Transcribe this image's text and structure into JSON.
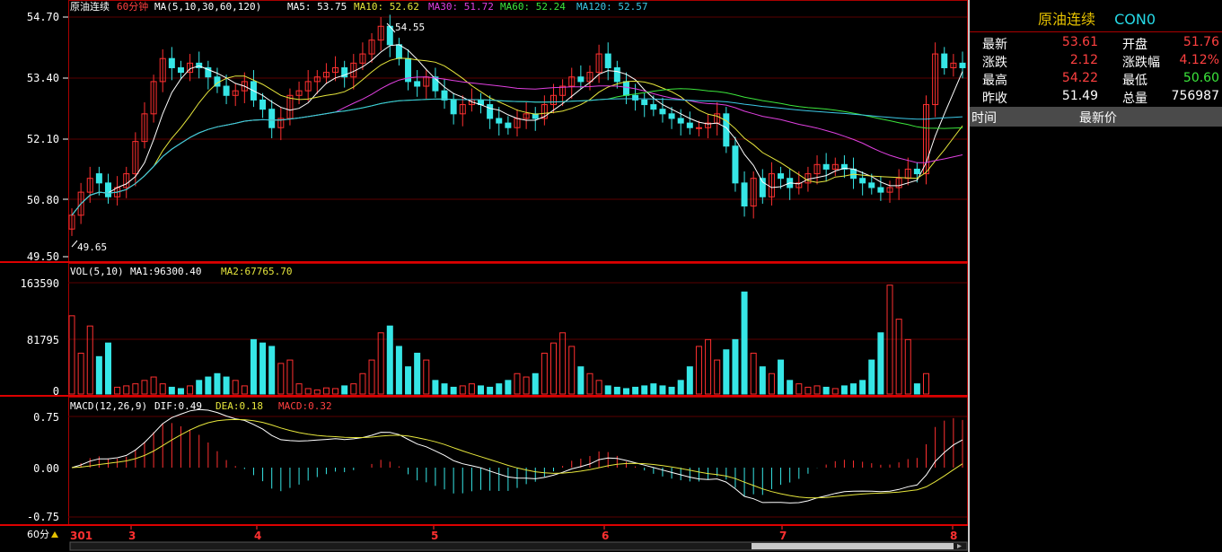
{
  "header": {
    "symbol_name": "原油连续",
    "period": "60分钟",
    "ma_params": "MA(5,10,30,60,120)",
    "ma5": "MA5: 53.75",
    "ma10": "MA10: 52.62",
    "ma30": "MA30: 51.72",
    "ma60": "MA60: 52.24",
    "ma120": "MA120: 52.57",
    "high_marker": "54.55",
    "low_marker": "49.65"
  },
  "price_axis": [
    "54.70",
    "53.40",
    "52.10",
    "50.80",
    "49.50"
  ],
  "volume_panel": {
    "title": "VOL(5,10)",
    "ma1": "MA1:96300.40",
    "ma2": "MA2:67765.70",
    "axis": [
      "163590",
      "81795",
      "0"
    ]
  },
  "macd_panel": {
    "title": "MACD(12,26,9)",
    "dif": "DIF:0.49",
    "dea": "DEA:0.18",
    "macd": "MACD:0.32",
    "axis": [
      "0.75",
      "0.00",
      "-0.75"
    ]
  },
  "x_axis": {
    "period_button": "60分",
    "labels": [
      "301",
      "3",
      "4",
      "5",
      "6",
      "7",
      "8"
    ]
  },
  "colors": {
    "up": "#ff3030",
    "down": "#36e6e6",
    "ma5": "#ffffff",
    "ma10": "#e6e63c",
    "ma30": "#e040e0",
    "ma60": "#3ce63c",
    "ma120": "#3cc8e6",
    "grid": "#7a0000"
  },
  "quote": {
    "name": "原油连续",
    "code": "CON0",
    "rows": [
      {
        "l1": "最新",
        "v1": "53.61",
        "c1": "red",
        "l2": "开盘",
        "v2": "51.76",
        "c2": "red"
      },
      {
        "l1": "涨跌",
        "v1": "2.12",
        "c1": "red",
        "l2": "涨跌幅",
        "v2": "4.12%",
        "c2": "red"
      },
      {
        "l1": "最高",
        "v1": "54.22",
        "c1": "red",
        "l2": "最低",
        "v2": "50.60",
        "c2": "green"
      },
      {
        "l1": "昨收",
        "v1": "51.49",
        "c1": "white",
        "l2": "总量",
        "v2": "756987",
        "c2": "white"
      }
    ],
    "trade_header": {
      "time": "时间",
      "price": "最新价"
    }
  },
  "chart_data": {
    "type": "candlestick",
    "price_range": [
      49.5,
      54.7
    ],
    "closes": [
      50.4,
      50.9,
      51.2,
      51.1,
      50.8,
      51.0,
      51.3,
      52.0,
      52.6,
      53.3,
      53.8,
      53.6,
      53.5,
      53.7,
      53.6,
      53.4,
      53.2,
      53.0,
      53.1,
      53.3,
      52.9,
      52.7,
      52.3,
      52.5,
      53.0,
      53.1,
      53.3,
      53.4,
      53.5,
      53.6,
      53.4,
      53.7,
      53.9,
      54.2,
      54.5,
      54.1,
      53.8,
      53.3,
      53.2,
      53.4,
      53.1,
      52.9,
      52.6,
      52.8,
      52.9,
      52.8,
      52.5,
      52.4,
      52.3,
      52.5,
      52.6,
      52.5,
      52.8,
      53.0,
      53.2,
      53.4,
      53.3,
      53.5,
      53.9,
      53.6,
      53.3,
      53.0,
      52.9,
      52.8,
      52.7,
      52.6,
      52.5,
      52.4,
      52.3,
      52.3,
      52.4,
      52.6,
      51.9,
      51.1,
      50.6,
      51.2,
      50.8,
      51.3,
      51.2,
      51.0,
      51.1,
      51.3,
      51.5,
      51.4,
      51.5,
      51.4,
      51.2,
      51.1,
      51.0,
      50.9,
      51.0,
      51.2,
      51.4,
      51.3,
      52.8,
      53.9,
      53.6,
      53.7,
      53.6
    ],
    "opens": [
      50.1,
      50.4,
      50.9,
      51.3,
      51.1,
      50.8,
      51.0,
      51.3,
      52.0,
      52.6,
      53.3,
      53.8,
      53.6,
      53.5,
      53.7,
      53.6,
      53.4,
      53.2,
      53.0,
      53.1,
      53.3,
      52.9,
      52.7,
      52.3,
      52.5,
      53.0,
      53.1,
      53.3,
      53.4,
      53.5,
      53.6,
      53.4,
      53.7,
      53.9,
      54.2,
      54.5,
      54.1,
      53.8,
      53.3,
      53.2,
      53.4,
      53.1,
      52.9,
      52.6,
      52.8,
      52.9,
      52.8,
      52.5,
      52.4,
      52.3,
      52.5,
      52.6,
      52.5,
      52.8,
      53.0,
      53.2,
      53.4,
      53.3,
      53.5,
      53.9,
      53.6,
      53.3,
      53.0,
      52.9,
      52.8,
      52.7,
      52.6,
      52.5,
      52.4,
      52.3,
      52.3,
      52.4,
      52.6,
      51.9,
      51.1,
      50.6,
      51.2,
      50.8,
      51.3,
      51.2,
      51.0,
      51.1,
      51.3,
      51.5,
      51.4,
      51.5,
      51.4,
      51.2,
      51.1,
      51.0,
      50.9,
      51.0,
      51.2,
      51.4,
      51.3,
      52.8,
      53.9,
      53.6,
      53.7
    ],
    "volume": [
      115000,
      60000,
      100000,
      55000,
      75000,
      10000,
      12000,
      15000,
      20000,
      25000,
      15000,
      10000,
      8000,
      12000,
      20000,
      25000,
      30000,
      25000,
      20000,
      12000,
      80000,
      75000,
      70000,
      45000,
      50000,
      15000,
      8000,
      6000,
      9000,
      8000,
      12000,
      15000,
      30000,
      50000,
      90000,
      100000,
      70000,
      40000,
      60000,
      50000,
      20000,
      15000,
      10000,
      12000,
      15000,
      12000,
      10000,
      15000,
      20000,
      30000,
      25000,
      30000,
      60000,
      75000,
      90000,
      70000,
      40000,
      30000,
      20000,
      12000,
      10000,
      8000,
      10000,
      12000,
      15000,
      12000,
      10000,
      20000,
      40000,
      70000,
      80000,
      50000,
      65000,
      80000,
      150000,
      60000,
      40000,
      30000,
      50000,
      20000,
      15000,
      10000,
      12000,
      10000,
      8000,
      12000,
      15000,
      20000,
      50000,
      90000,
      160000,
      110000,
      80000,
      15000,
      30000
    ]
  }
}
